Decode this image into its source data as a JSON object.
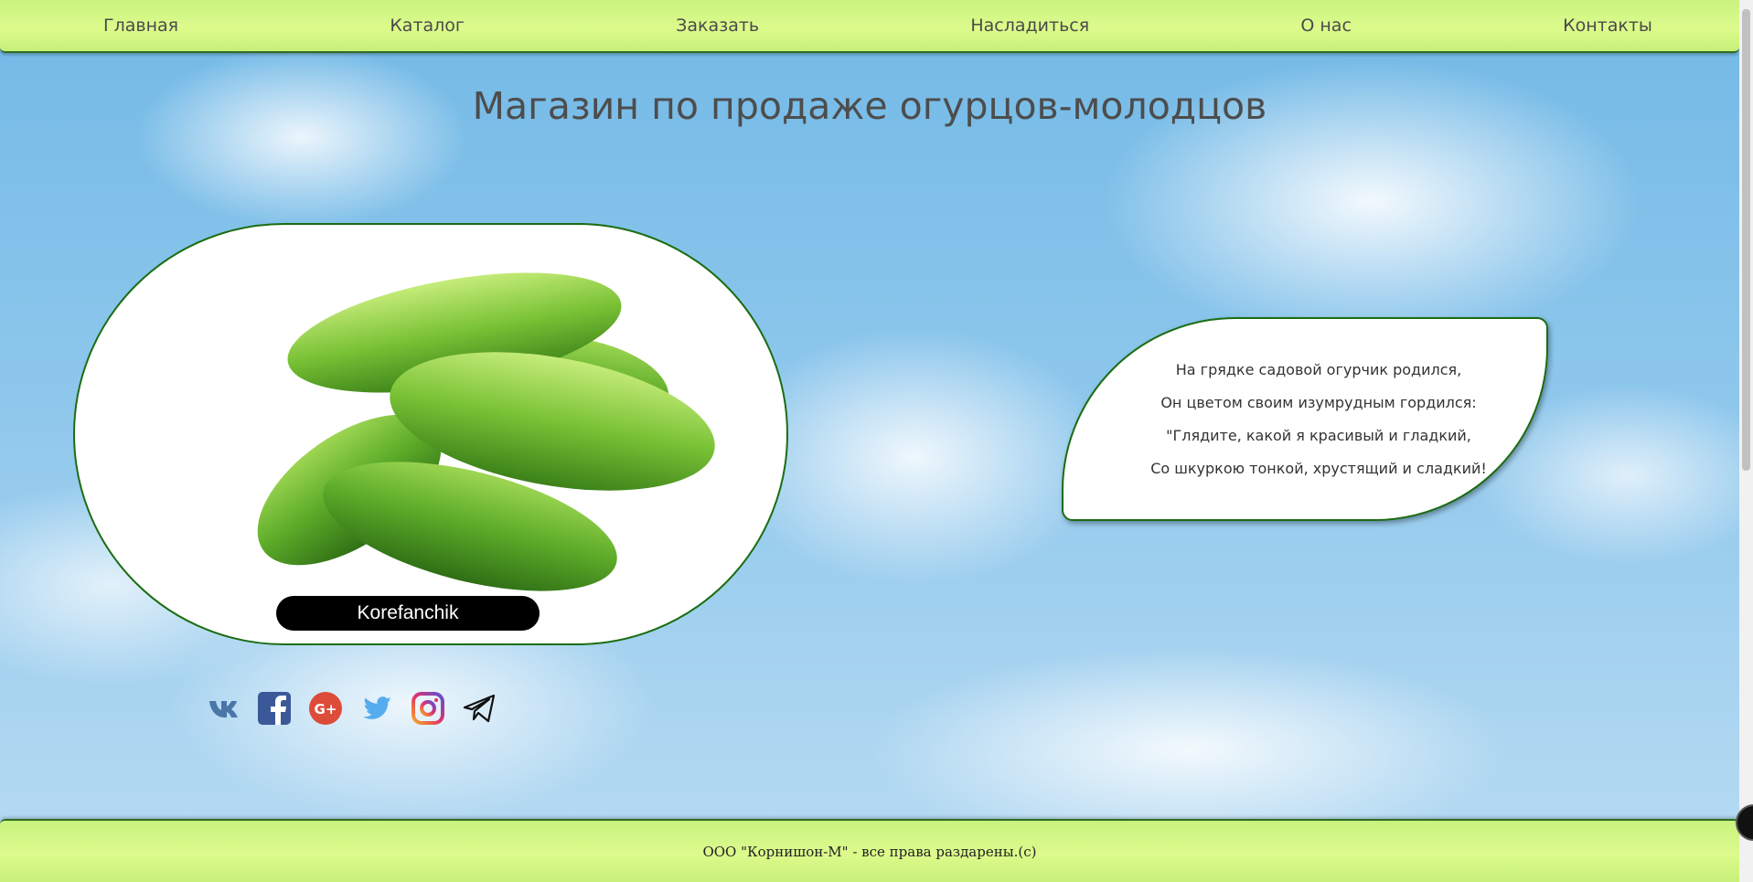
{
  "nav": {
    "items": [
      {
        "label": "Главная"
      },
      {
        "label": "Каталог"
      },
      {
        "label": "Заказать"
      },
      {
        "label": "Насладиться"
      },
      {
        "label": "О нас"
      },
      {
        "label": "Контакты"
      }
    ]
  },
  "main": {
    "title": "Магазин по продаже огурцов-молодцов",
    "photo_caption": "Korefanchik",
    "poem": [
      "На грядке садовой огурчик родился,",
      "Он цветом своим изумрудным гордился:",
      "\"Глядите, какой я красивый и гладкий,",
      "Со шкуркою тонкой, хрустящий и сладкий!"
    ]
  },
  "socials": [
    {
      "icon": "vk-icon",
      "color": "#4a76a8"
    },
    {
      "icon": "facebook-icon",
      "color": "#3b5998"
    },
    {
      "icon": "google-plus-icon",
      "color": "#dd4b39"
    },
    {
      "icon": "twitter-icon",
      "color": "#55acee"
    },
    {
      "icon": "instagram-icon",
      "color": "#c13584"
    },
    {
      "icon": "telegram-icon",
      "color": "#111111"
    }
  ],
  "footer": {
    "text": "ООО \"Корнишон-М\" - все права раздарены.(с)"
  },
  "colors": {
    "bar_green": "#d4f886",
    "border_green": "#1a6d12",
    "title_gray": "#4d4d4d"
  }
}
